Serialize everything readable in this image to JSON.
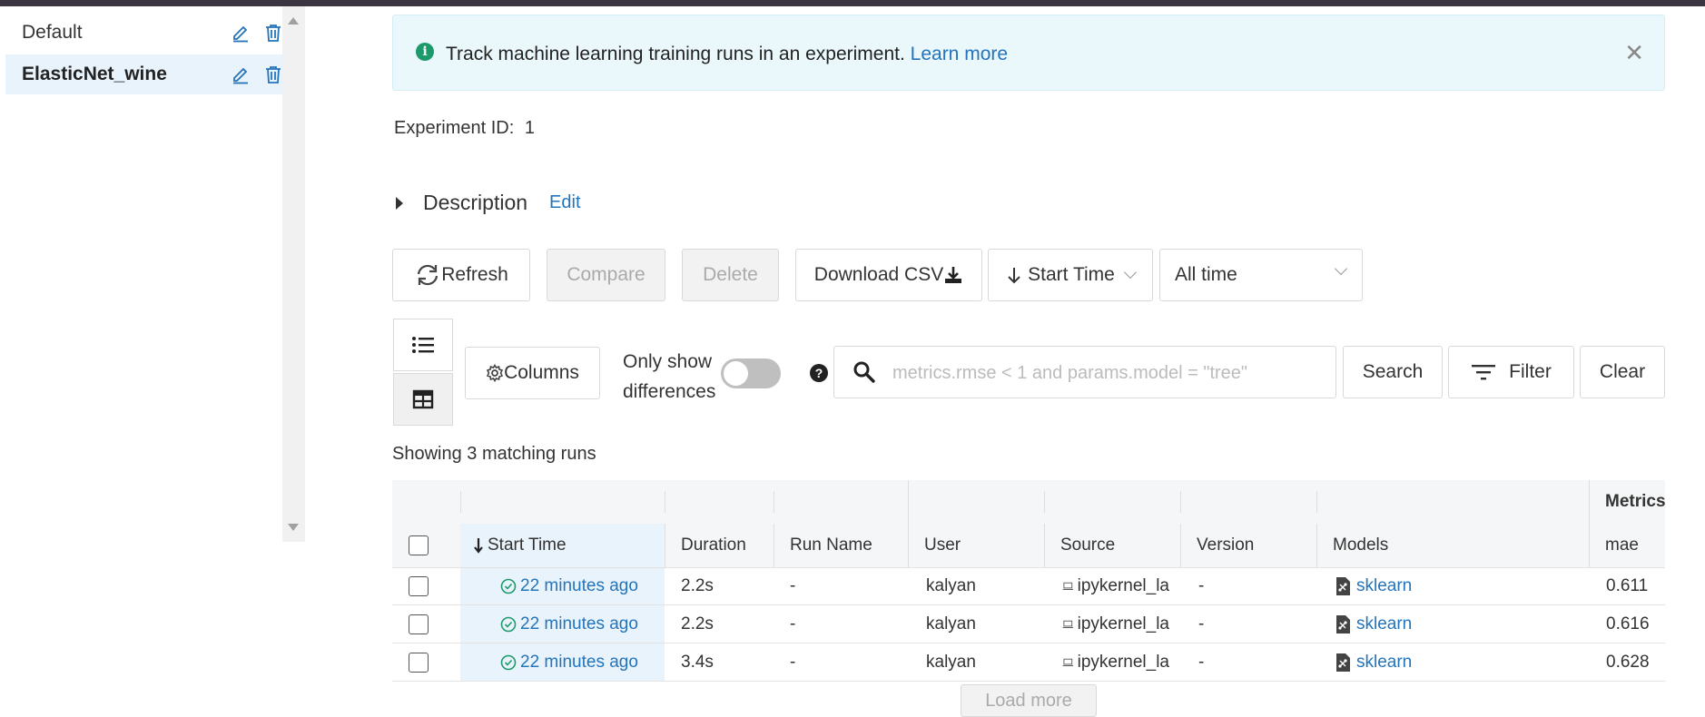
{
  "sidebar": {
    "experiments": [
      {
        "name": "Default"
      },
      {
        "name": "ElasticNet_wine"
      }
    ]
  },
  "banner": {
    "message": "Track machine learning training runs in an experiment.",
    "link": "Learn more"
  },
  "experiment": {
    "id_label": "Experiment ID:",
    "id_value": "1",
    "description_label": "Description",
    "edit_label": "Edit"
  },
  "toolbar": {
    "refresh": "Refresh",
    "compare": "Compare",
    "delete": "Delete",
    "download_csv": "Download CSV",
    "sort_label": "Start Time",
    "time_range": "All time"
  },
  "controls": {
    "columns": "Columns",
    "only_show_line1": "Only show",
    "only_show_line2": "differences",
    "search_placeholder": "metrics.rmse < 1 and params.model = \"tree\"",
    "search": "Search",
    "filter": "Filter",
    "clear": "Clear"
  },
  "showing": "Showing 3 matching runs",
  "table": {
    "group_header": "Metrics",
    "columns": [
      "Start Time",
      "Duration",
      "Run Name",
      "User",
      "Source",
      "Version",
      "Models",
      "mae"
    ],
    "rows": [
      {
        "start": "22 minutes ago",
        "duration": "2.2s",
        "run_name": "-",
        "user": "kalyan",
        "source": "ipykernel_la",
        "version": "-",
        "model": "sklearn",
        "mae": "0.611"
      },
      {
        "start": "22 minutes ago",
        "duration": "2.2s",
        "run_name": "-",
        "user": "kalyan",
        "source": "ipykernel_la",
        "version": "-",
        "model": "sklearn",
        "mae": "0.616"
      },
      {
        "start": "22 minutes ago",
        "duration": "3.4s",
        "run_name": "-",
        "user": "kalyan",
        "source": "ipykernel_la",
        "version": "-",
        "model": "sklearn",
        "mae": "0.628"
      }
    ]
  },
  "load_more": "Load more",
  "colors": {
    "accent": "#2374bb",
    "success": "#1d9a6c",
    "selected_bg": "#e9f3fc"
  }
}
